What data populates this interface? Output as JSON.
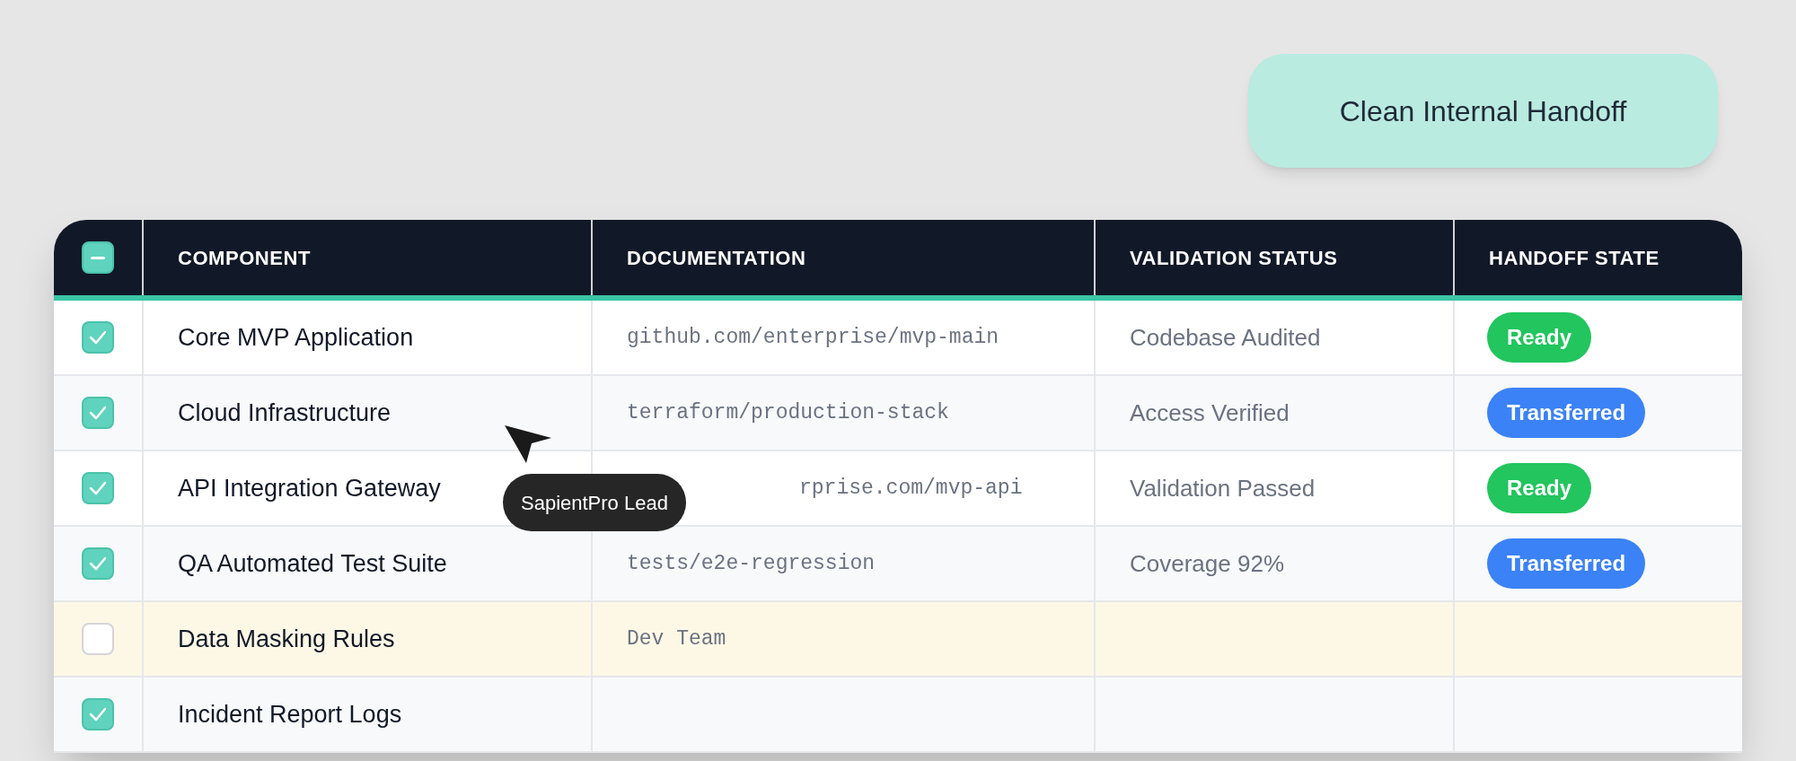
{
  "handoff_button": {
    "label": "Clean Internal Handoff"
  },
  "table": {
    "select_all": {
      "indeterminate": true
    },
    "columns": [
      "COMPONENT",
      "DOCUMENTATION",
      "VALIDATION STATUS",
      "HANDOFF STATE"
    ],
    "rows": [
      {
        "checked": true,
        "highlighted": false,
        "component": "Core MVP Application",
        "documentation": "github.com/enterprise/mvp-main",
        "validation_status": "Codebase Audited",
        "handoff_state": {
          "label": "Ready",
          "kind": "ready"
        }
      },
      {
        "checked": true,
        "highlighted": false,
        "component": "Cloud Infrastructure",
        "documentation": "terraform/production-stack",
        "validation_status": "Access Verified",
        "handoff_state": {
          "label": "Transferred",
          "kind": "transferred"
        }
      },
      {
        "checked": true,
        "highlighted": false,
        "component": "API Integration Gateway",
        "documentation": "rprise.com/mvp-api",
        "validation_status": "Validation Passed",
        "handoff_state": {
          "label": "Ready",
          "kind": "ready"
        },
        "tooltip": "SapientPro Lead"
      },
      {
        "checked": true,
        "highlighted": false,
        "component": "QA Automated Test Suite",
        "documentation": "tests/e2e-regression",
        "validation_status": "Coverage 92%",
        "handoff_state": {
          "label": "Transferred",
          "kind": "transferred"
        }
      },
      {
        "checked": false,
        "highlighted": true,
        "component": "Data Masking Rules",
        "documentation": "Dev Team"
      },
      {
        "checked": true,
        "highlighted": false,
        "component": "Incident Report Logs"
      }
    ]
  }
}
